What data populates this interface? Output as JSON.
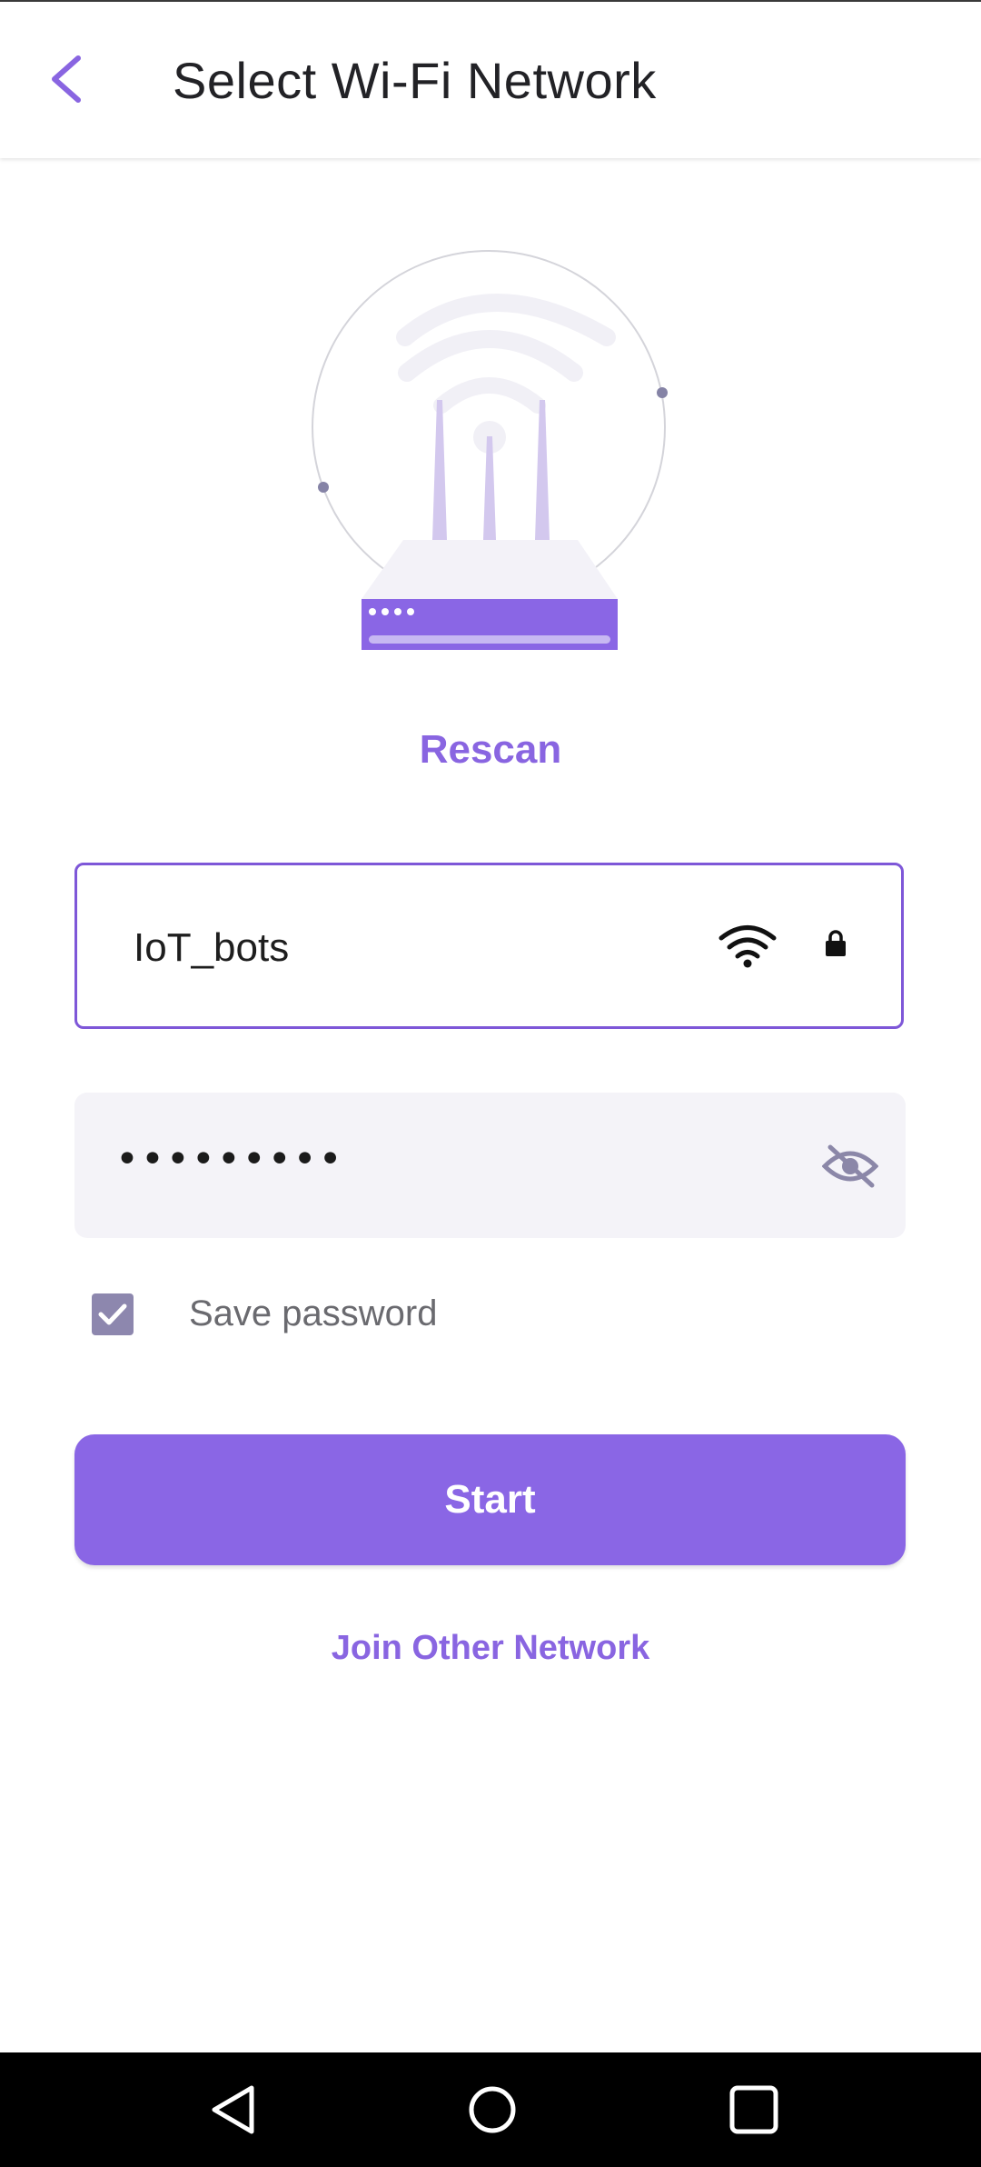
{
  "header": {
    "title": "Select Wi-Fi Network",
    "back_icon": "chevron-left-icon",
    "accent_color": "#8965e1"
  },
  "illustration": {
    "icon": "wifi-router-illustration"
  },
  "rescan_label": "Rescan",
  "network": {
    "ssid": "IoT_bots",
    "signal_icon": "wifi-icon",
    "security_icon": "lock-icon"
  },
  "password": {
    "masked_value": "•••••••••",
    "visibility_icon": "eye-off-icon"
  },
  "save_password": {
    "label": "Save password",
    "checked": true
  },
  "start_label": "Start",
  "join_other_label": "Join Other Network",
  "navbar": {
    "back_icon": "triangle-back-icon",
    "home_icon": "circle-home-icon",
    "recents_icon": "square-recents-icon"
  }
}
